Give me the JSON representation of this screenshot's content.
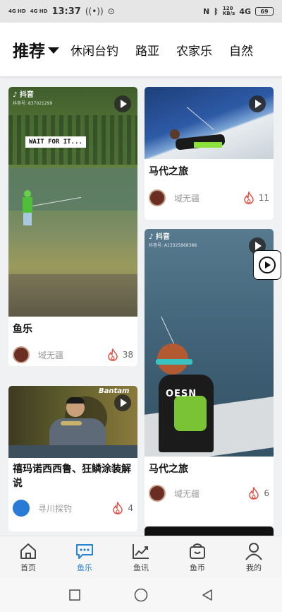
{
  "status_bar": {
    "signal_1": "4G HD",
    "signal_2": "4G HD",
    "time": "13:37",
    "net_speed_value": "120",
    "net_speed_unit": "KB/s",
    "network": "4G",
    "battery": "69"
  },
  "top_tabs": {
    "active": "推荐",
    "items": [
      "休闲台钓",
      "路亚",
      "农家乐",
      "自然"
    ]
  },
  "cards": [
    {
      "title": "鱼乐",
      "author": "域无疆",
      "likes": "38",
      "watermark_brand": "抖音",
      "watermark_id": "抖音号: 837021299",
      "overlay_text": "WAIT FOR IT..."
    },
    {
      "title": "马代之旅",
      "author": "域无疆",
      "likes": "11"
    },
    {
      "title": "马代之旅",
      "author": "域无疆",
      "likes": "6",
      "watermark_brand": "抖音",
      "watermark_id": "抖音号: A13325868388",
      "shirt_text": "OESN"
    },
    {
      "title": "禧玛诺西西鲁、狂鳞涂装解说",
      "author": "寻川探钓",
      "likes": "4",
      "overlay_text": "Bantam"
    }
  ],
  "bottom_nav": [
    {
      "label": "首页",
      "icon": "home-icon"
    },
    {
      "label": "鱼乐",
      "icon": "chat-bubble-icon"
    },
    {
      "label": "鱼讯",
      "icon": "trend-chart-icon"
    },
    {
      "label": "鱼币",
      "icon": "wallet-bag-icon"
    },
    {
      "label": "我的",
      "icon": "user-icon"
    }
  ],
  "colors": {
    "accent": "#2a84d6",
    "like_red": "#e2473b",
    "feed_bg": "#f0f1f3"
  }
}
